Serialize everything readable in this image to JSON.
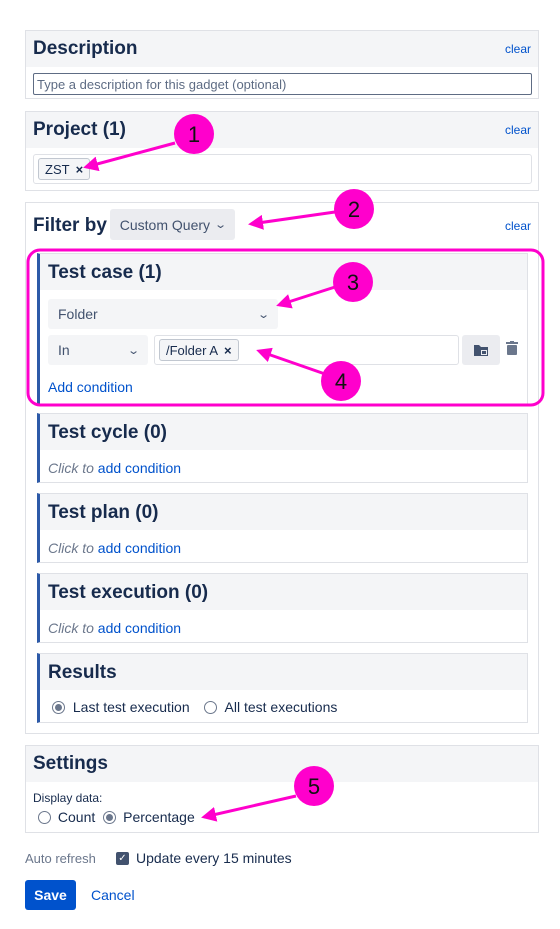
{
  "description": {
    "title": "Description",
    "clear": "clear",
    "placeholder": "Type a description for this gadget (optional)"
  },
  "project": {
    "title": "Project (1)",
    "clear": "clear",
    "tag": "ZST",
    "remove": "×"
  },
  "filter": {
    "label": "Filter by",
    "mode": "Custom Query",
    "clear": "clear",
    "test_case": {
      "title": "Test case (1)",
      "field_select": "Folder",
      "operator_select": "In",
      "value_tag": "/Folder A",
      "remove": "×",
      "add_condition": "Add condition"
    },
    "test_cycle": {
      "title": "Test cycle (0)",
      "click_to": "Click to",
      "add_condition": "add condition"
    },
    "test_plan": {
      "title": "Test plan (0)",
      "click_to": "Click to",
      "add_condition": "add condition"
    },
    "test_execution": {
      "title": "Test execution (0)",
      "click_to": "Click to",
      "add_condition": "add condition"
    },
    "results": {
      "title": "Results",
      "options": [
        "Last test execution",
        "All test executions"
      ],
      "selected": "Last test execution"
    }
  },
  "settings": {
    "title": "Settings",
    "display_label": "Display data:",
    "options": [
      "Count",
      "Percentage"
    ],
    "selected": "Percentage"
  },
  "auto_refresh": {
    "label": "Auto refresh",
    "checkbox_label": "Update every 15 minutes",
    "checked": true
  },
  "actions": {
    "save": "Save",
    "cancel": "Cancel"
  },
  "callouts": [
    "1",
    "2",
    "3",
    "4",
    "5"
  ],
  "colors": {
    "accent": "#0052cc",
    "callout": "#ff00cc",
    "save_bg": "#0052cc"
  }
}
